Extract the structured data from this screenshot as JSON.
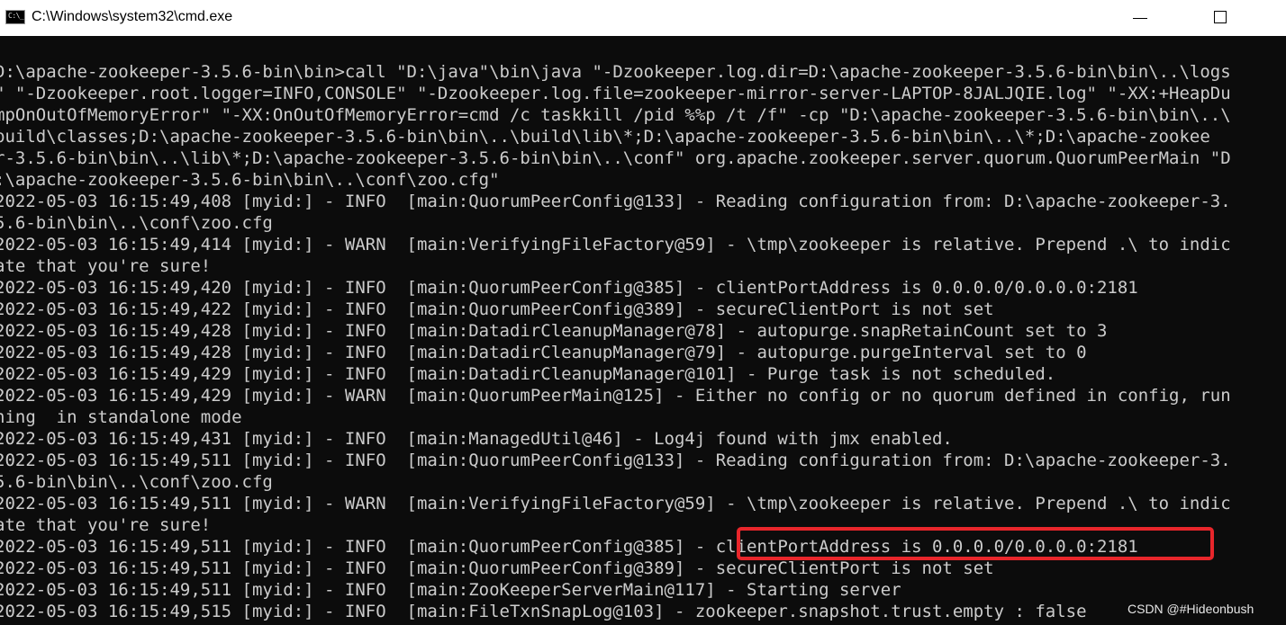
{
  "window": {
    "title": "C:\\Windows\\system32\\cmd.exe",
    "icon_text": "C:\\_",
    "icon": "cmd-icon"
  },
  "console": {
    "lines": [
      "D:\\apache-zookeeper-3.5.6-bin\\bin>call \"D:\\java\"\\bin\\java \"-Dzookeeper.log.dir=D:\\apache-zookeeper-3.5.6-bin\\bin\\..\\logs",
      "\" \"-Dzookeeper.root.logger=INFO,CONSOLE\" \"-Dzookeeper.log.file=zookeeper-mirror-server-LAPTOP-8JALJQIE.log\" \"-XX:+HeapDu",
      "mpOnOutOfMemoryError\" \"-XX:OnOutOfMemoryError=cmd /c taskkill /pid %%p /t /f\" -cp \"D:\\apache-zookeeper-3.5.6-bin\\bin\\..\\",
      "build\\classes;D:\\apache-zookeeper-3.5.6-bin\\bin\\..\\build\\lib\\*;D:\\apache-zookeeper-3.5.6-bin\\bin\\..\\*;D:\\apache-zookee",
      "r-3.5.6-bin\\bin\\..\\lib\\*;D:\\apache-zookeeper-3.5.6-bin\\bin\\..\\conf\" org.apache.zookeeper.server.quorum.QuorumPeerMain \"D",
      ":\\apache-zookeeper-3.5.6-bin\\bin\\..\\conf\\zoo.cfg\"",
      "2022-05-03 16:15:49,408 [myid:] - INFO  [main:QuorumPeerConfig@133] - Reading configuration from: D:\\apache-zookeeper-3.",
      "5.6-bin\\bin\\..\\conf\\zoo.cfg",
      "2022-05-03 16:15:49,414 [myid:] - WARN  [main:VerifyingFileFactory@59] - \\tmp\\zookeeper is relative. Prepend .\\ to indic",
      "ate that you're sure!",
      "2022-05-03 16:15:49,420 [myid:] - INFO  [main:QuorumPeerConfig@385] - clientPortAddress is 0.0.0.0/0.0.0.0:2181",
      "2022-05-03 16:15:49,422 [myid:] - INFO  [main:QuorumPeerConfig@389] - secureClientPort is not set",
      "2022-05-03 16:15:49,428 [myid:] - INFO  [main:DatadirCleanupManager@78] - autopurge.snapRetainCount set to 3",
      "2022-05-03 16:15:49,428 [myid:] - INFO  [main:DatadirCleanupManager@79] - autopurge.purgeInterval set to 0",
      "2022-05-03 16:15:49,429 [myid:] - INFO  [main:DatadirCleanupManager@101] - Purge task is not scheduled.",
      "2022-05-03 16:15:49,429 [myid:] - WARN  [main:QuorumPeerMain@125] - Either no config or no quorum defined in config, run",
      "ning  in standalone mode",
      "2022-05-03 16:15:49,431 [myid:] - INFO  [main:ManagedUtil@46] - Log4j found with jmx enabled.",
      "2022-05-03 16:15:49,511 [myid:] - INFO  [main:QuorumPeerConfig@133] - Reading configuration from: D:\\apache-zookeeper-3.",
      "5.6-bin\\bin\\..\\conf\\zoo.cfg",
      "2022-05-03 16:15:49,511 [myid:] - WARN  [main:VerifyingFileFactory@59] - \\tmp\\zookeeper is relative. Prepend .\\ to indic",
      "ate that you're sure!",
      "2022-05-03 16:15:49,511 [myid:] - INFO  [main:QuorumPeerConfig@385] - clientPortAddress is 0.0.0.0/0.0.0.0:2181",
      "2022-05-03 16:15:49,511 [myid:] - INFO  [main:QuorumPeerConfig@389] - secureClientPort is not set",
      "2022-05-03 16:15:49,511 [myid:] - INFO  [main:ZooKeeperServerMain@117] - Starting server",
      "2022-05-03 16:15:49,515 [myid:] - INFO  [main:FileTxnSnapLog@103] - zookeeper.snapshot.trust.empty : false"
    ]
  },
  "watermark": "CSDN @#Hideonbush",
  "colors": {
    "console_bg": "#0c0c0c",
    "console_text": "#cccccc",
    "highlight": "#e8262b",
    "titlebar_bg": "#ffffff"
  }
}
